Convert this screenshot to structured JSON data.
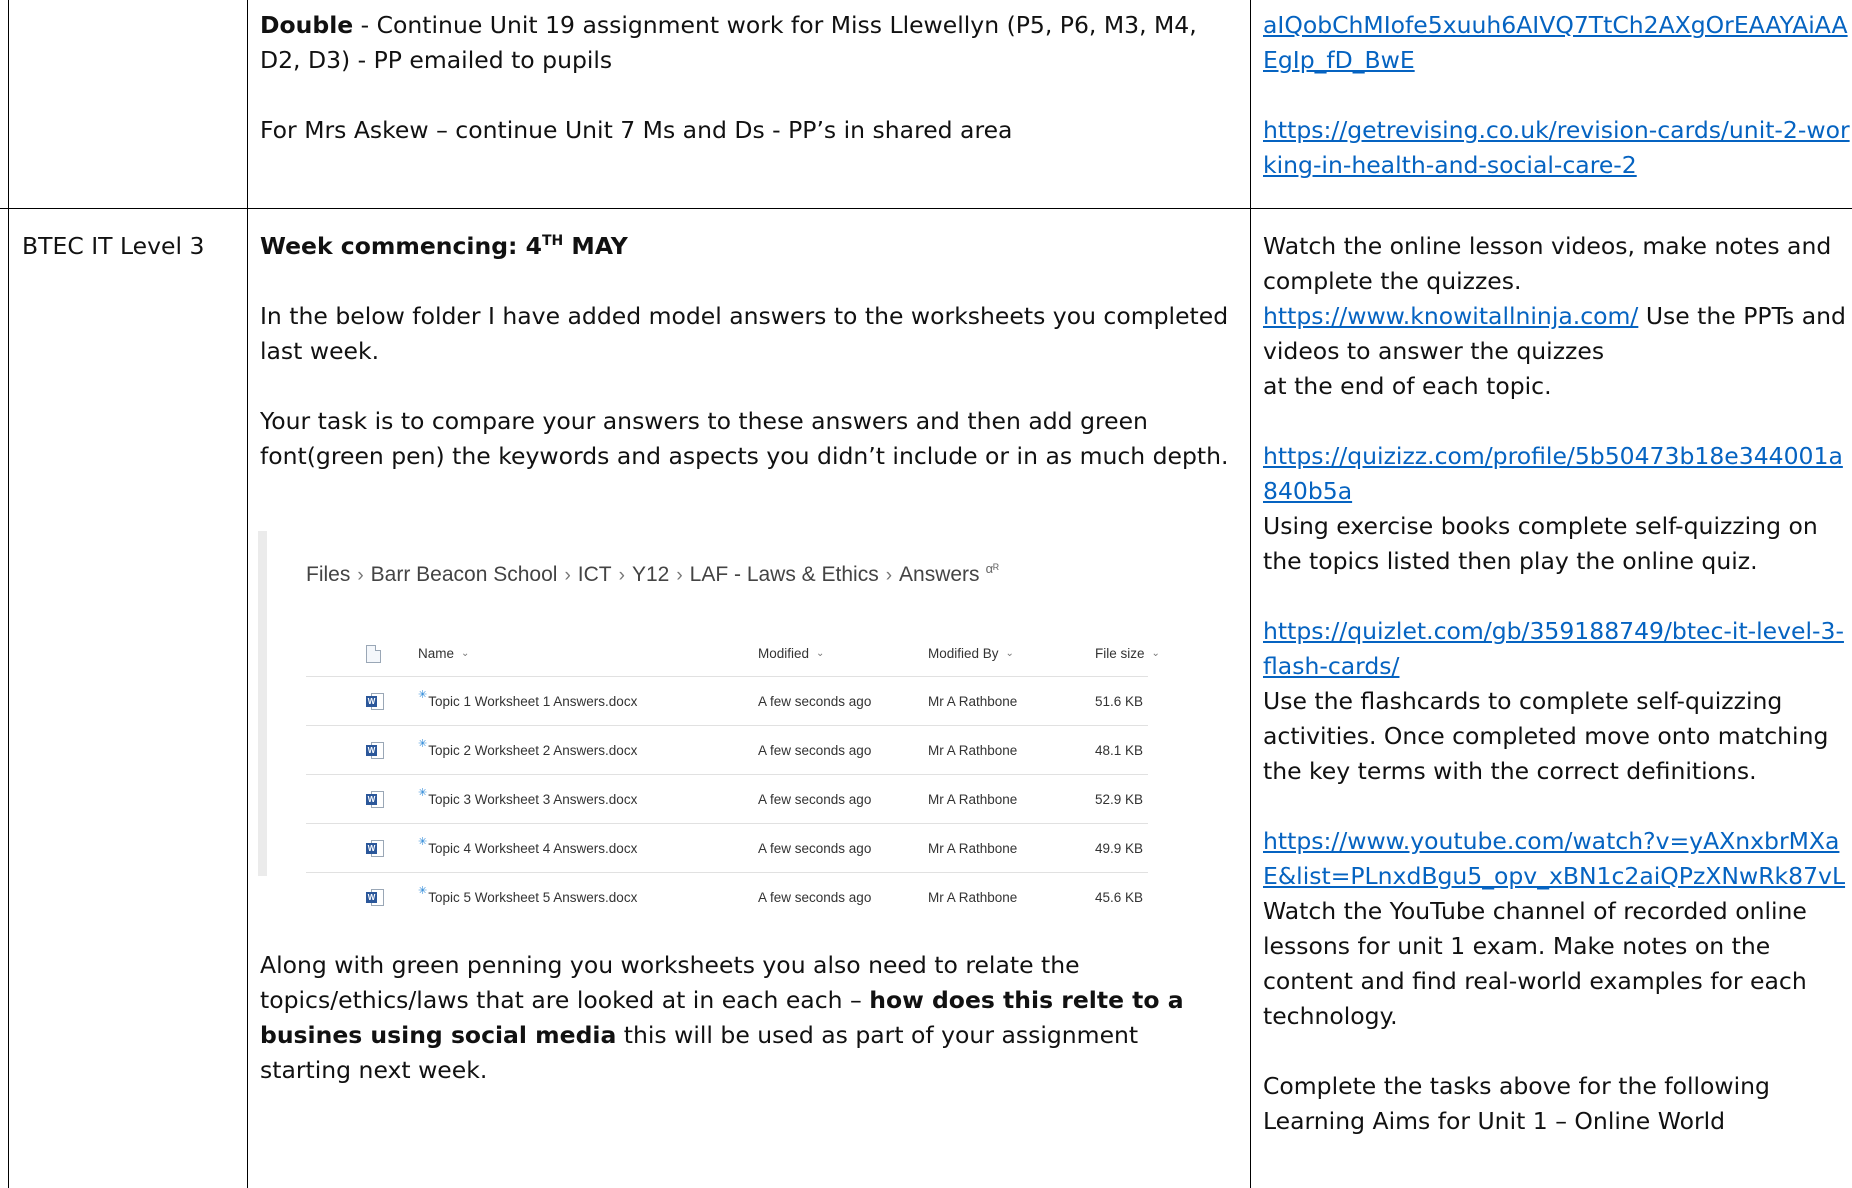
{
  "row1": {
    "col2": {
      "line1_bold": "Double",
      "line1_rest": " - Continue Unit 19 assignment work for Miss Llewellyn (P5, P6, M3, M4,",
      "line2": "D2, D3) - PP emailed to pupils",
      "line3": "For Mrs Askew – continue Unit 7 Ms and Ds - PP’s in shared area"
    },
    "col3": {
      "link1": "aIQobChMIofe5xuuh6AIVQ7TtCh2AXgOrEAAYAiAAEgIp_fD_BwE",
      "link2": "https://getrevising.co.uk/revision-cards/unit-2-working-in-health-and-social-care-2"
    }
  },
  "row2": {
    "col1": "BTEC IT Level 3",
    "col2": {
      "week_label": "Week commencing: 4",
      "week_sup": "TH",
      "week_month": " MAY",
      "para1": "In the below folder I have added model answers to the worksheets you completed last week.",
      "para2": "Your task is to compare your answers to these answers and then add green font(green pen) the keywords and aspects you didn’t include or in as much depth.",
      "files": {
        "breadcrumb": [
          "Files",
          "Barr Beacon School",
          "ICT",
          "Y12",
          "LAF - Laws & Ethics",
          "Answers"
        ],
        "share_icon": "people-icon",
        "headers": {
          "name": "Name",
          "modified": "Modified",
          "modified_by": "Modified By",
          "size": "File size"
        },
        "rows": [
          {
            "name": "Topic 1 Worksheet 1 Answers.docx",
            "modified": "A few seconds ago",
            "by": "Mr A Rathbone",
            "size": "51.6 KB"
          },
          {
            "name": "Topic 2 Worksheet 2 Answers.docx",
            "modified": "A few seconds ago",
            "by": "Mr A Rathbone",
            "size": "48.1 KB"
          },
          {
            "name": "Topic 3 Worksheet 3 Answers.docx",
            "modified": "A few seconds ago",
            "by": "Mr A Rathbone",
            "size": "52.9 KB"
          },
          {
            "name": "Topic 4 Worksheet 4 Answers.docx",
            "modified": "A few seconds ago",
            "by": "Mr A Rathbone",
            "size": "49.9 KB"
          },
          {
            "name": "Topic 5 Worksheet 5 Answers.docx",
            "modified": "A few seconds ago",
            "by": "Mr A Rathbone",
            "size": "45.6 KB"
          }
        ]
      },
      "para3_start": "Along with green penning you worksheets you also need to relate the topics/ethics/laws that are looked at in each each – ",
      "para3_bold": "how does this relte to a busines using social media",
      "para3_end": "  this will be used as part of your assignment starting next week."
    },
    "col3": {
      "p1": "Watch the online lesson videos, make notes and complete the quizzes.",
      "p1_link": "https://www.knowitallninja.com/",
      "p1_after": " Use the PPTs and videos to answer the quizzes",
      "p1_end": " at the end of each topic.",
      "p2_link": "https://quizizz.com/profile/5b50473b18e344001a840b5a",
      "p2_text": "Using exercise books complete self-quizzing on the topics listed then play the online quiz.",
      "p3_link": "https://quizlet.com/gb/359188749/btec-it-level-3-flash-cards/",
      "p3_text": "Use the flashcards to complete self-quizzing activities. Once completed move onto matching the key terms with the correct definitions.",
      "p4_link": "https://www.youtube.com/watch?v=yAXnxbrMXaE&list=PLnxdBgu5_opv_xBN1c2aiQPzXNwRk87vL",
      "p4_text": " Watch the YouTube channel of recorded online lessons for unit 1 exam. Make notes on the content and find real-world examples for each technology.",
      "p5": "Complete the tasks above for the following Learning Aims for Unit 1 – Online World"
    }
  }
}
